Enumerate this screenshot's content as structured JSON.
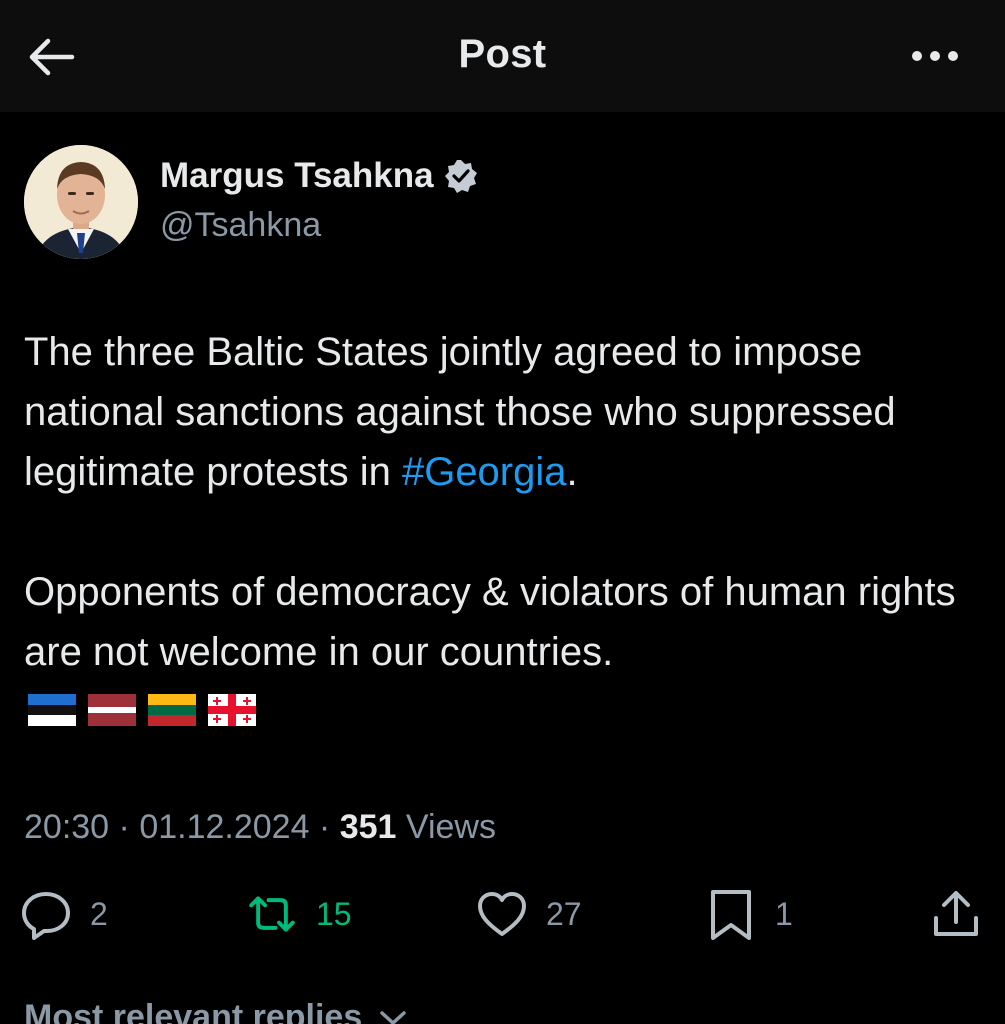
{
  "header": {
    "title": "Post"
  },
  "author": {
    "display_name": "Margus Tsahkna",
    "handle": "@Tsahkna",
    "verified": true
  },
  "tweet": {
    "line1_prefix": "The three Baltic States jointly agreed to impose national sanctions against those who suppressed legitimate protests in ",
    "hashtag": "#Georgia",
    "line1_suffix": ".",
    "paragraph2": "Opponents of democracy & violators of human rights are not welcome in our countries.",
    "flags": [
      "flag-estonia",
      "flag-latvia",
      "flag-lithuania",
      "flag-georgia"
    ]
  },
  "meta": {
    "time": "20:30",
    "separator": " · ",
    "date": "01.12.2024",
    "views_count": "351",
    "views_label": "Views"
  },
  "actions": {
    "replies": "2",
    "reposts": "15",
    "likes": "27",
    "bookmarks": "1"
  },
  "replies_section": {
    "label": "Most relevant replies"
  },
  "colors": {
    "background": "#000000",
    "header_bg": "#0d0d0d",
    "text": "#e7e9ea",
    "secondary": "#8b98a5",
    "link": "#1d9bf0",
    "repost": "#00ba7c"
  }
}
